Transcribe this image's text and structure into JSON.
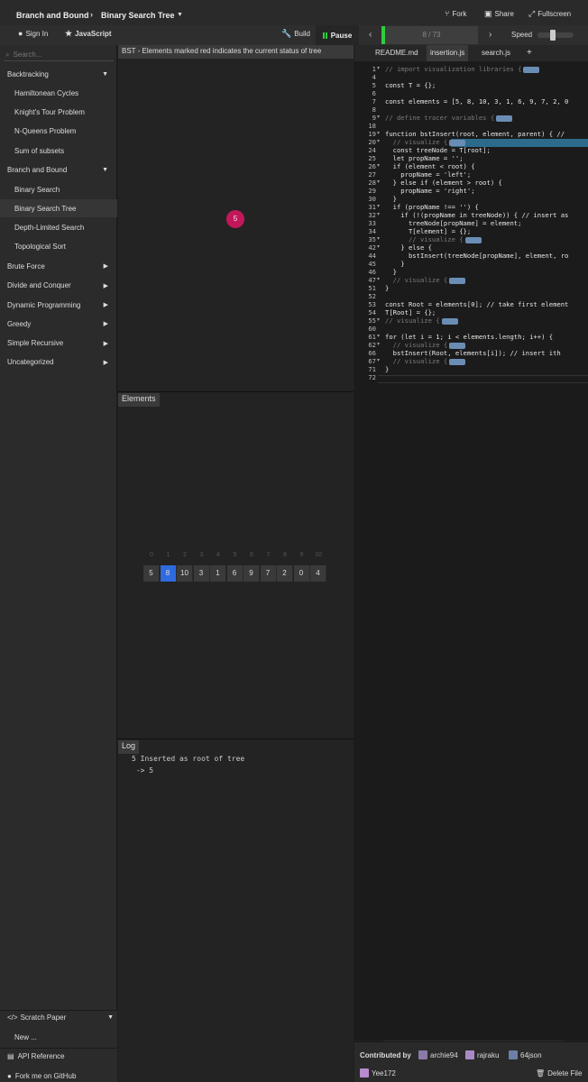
{
  "header": {
    "crumb1": "Branch and Bound",
    "crumb2": "Binary Search Tree",
    "fork": "Fork",
    "share": "Share",
    "fullscreen": "Fullscreen"
  },
  "toolbar": {
    "signin": "Sign In",
    "language": "JavaScript",
    "build": "Build",
    "pause": "Pause",
    "progress_text": "8 / 73",
    "speed": "Speed"
  },
  "sidebar": {
    "search_placeholder": "Search...",
    "items": [
      {
        "label": "Backtracking",
        "type": "cat",
        "expanded": true
      },
      {
        "label": "Hamiltonean Cycles",
        "type": "sub"
      },
      {
        "label": "Knight's Tour Problem",
        "type": "sub"
      },
      {
        "label": "N-Queens Problem",
        "type": "sub"
      },
      {
        "label": "Sum of subsets",
        "type": "sub"
      },
      {
        "label": "Branch and Bound",
        "type": "cat",
        "expanded": true
      },
      {
        "label": "Binary Search",
        "type": "sub"
      },
      {
        "label": "Binary Search Tree",
        "type": "sub",
        "active": true
      },
      {
        "label": "Depth-Limited Search",
        "type": "sub"
      },
      {
        "label": "Topological Sort",
        "type": "sub"
      },
      {
        "label": "Brute Force",
        "type": "cat"
      },
      {
        "label": "Divide and Conquer",
        "type": "cat"
      },
      {
        "label": "Dynamic Programming",
        "type": "cat"
      },
      {
        "label": "Greedy",
        "type": "cat"
      },
      {
        "label": "Simple Recursive",
        "type": "cat"
      },
      {
        "label": "Uncategorized",
        "type": "cat"
      }
    ],
    "scratch": "Scratch Paper",
    "new": "New ...",
    "api": "API Reference",
    "github": "Fork me on GitHub"
  },
  "viz": {
    "tree_title": "BST - Elements marked red indicates the current status of tree",
    "node_value": "5",
    "elements_title": "Elements",
    "indices": [
      "0",
      "1",
      "2",
      "3",
      "4",
      "5",
      "6",
      "7",
      "8",
      "9",
      "10"
    ],
    "values": [
      "5",
      "8",
      "10",
      "3",
      "1",
      "6",
      "9",
      "7",
      "2",
      "0",
      "4"
    ],
    "log_title": "Log",
    "log_lines": [
      "5 Inserted as root of tree",
      " -> 5"
    ]
  },
  "editor": {
    "tabs": [
      "README.md",
      "insertion.js",
      "search.js",
      "+"
    ],
    "lines": [
      {
        "n": "1",
        "fold": true,
        "code": "// import visualization libraries {"
      },
      {
        "n": "4",
        "code": ""
      },
      {
        "n": "5",
        "code": "const T = {};"
      },
      {
        "n": "6",
        "code": ""
      },
      {
        "n": "7",
        "code": "const elements = [5, 8, 10, 3, 1, 6, 9, 7, 2, 0"
      },
      {
        "n": "8",
        "code": ""
      },
      {
        "n": "9",
        "fold": true,
        "code": "// define tracer variables {"
      },
      {
        "n": "18",
        "code": ""
      },
      {
        "n": "19",
        "fold": true,
        "code": "function bstInsert(root, element, parent) { //"
      },
      {
        "n": "20",
        "fold": true,
        "code": "  // visualize {"
      },
      {
        "n": "24",
        "code": "  const treeNode = T[root];"
      },
      {
        "n": "25",
        "code": "  let propName = '';"
      },
      {
        "n": "26",
        "fold": true,
        "code": "  if (element < root) {"
      },
      {
        "n": "27",
        "code": "    propName = 'left';"
      },
      {
        "n": "28",
        "fold": true,
        "code": "  } else if (element > root) {"
      },
      {
        "n": "29",
        "code": "    propName = 'right';"
      },
      {
        "n": "30",
        "code": "  }"
      },
      {
        "n": "31",
        "fold": true,
        "code": "  if (propName !== '') {"
      },
      {
        "n": "32",
        "fold": true,
        "code": "    if (!(propName in treeNode)) { // insert as"
      },
      {
        "n": "33",
        "code": "      treeNode[propName] = element;"
      },
      {
        "n": "34",
        "code": "      T[element] = {};"
      },
      {
        "n": "35",
        "fold": true,
        "code": "      // visualize {"
      },
      {
        "n": "42",
        "fold": true,
        "code": "    } else {"
      },
      {
        "n": "44",
        "code": "      bstInsert(treeNode[propName], element, ro"
      },
      {
        "n": "45",
        "code": "    }"
      },
      {
        "n": "46",
        "code": "  }"
      },
      {
        "n": "47",
        "fold": true,
        "code": "  // visualize {"
      },
      {
        "n": "51",
        "code": "}"
      },
      {
        "n": "52",
        "code": ""
      },
      {
        "n": "53",
        "code": "const Root = elements[0]; // take first element"
      },
      {
        "n": "54",
        "code": "T[Root] = {};"
      },
      {
        "n": "55",
        "fold": true,
        "code": "// visualize {"
      },
      {
        "n": "60",
        "code": ""
      },
      {
        "n": "61",
        "fold": true,
        "code": "for (let i = 1; i < elements.length; i++) {"
      },
      {
        "n": "62",
        "fold": true,
        "code": "  // visualize {"
      },
      {
        "n": "66",
        "code": "  bstInsert(Root, elements[i]); // insert ith"
      },
      {
        "n": "67",
        "fold": true,
        "code": "  // visualize {"
      },
      {
        "n": "71",
        "code": "}"
      },
      {
        "n": "72",
        "code": ""
      }
    ]
  },
  "footer": {
    "contributed_by": "Contributed by",
    "contributors": [
      "archie94",
      "rajraku",
      "64json",
      "Yee172"
    ],
    "delete": "Delete File"
  },
  "colors": {
    "accent_green": "#2ecc40",
    "node_red": "#c2185b",
    "highlight_blue": "#2f6ae0"
  }
}
